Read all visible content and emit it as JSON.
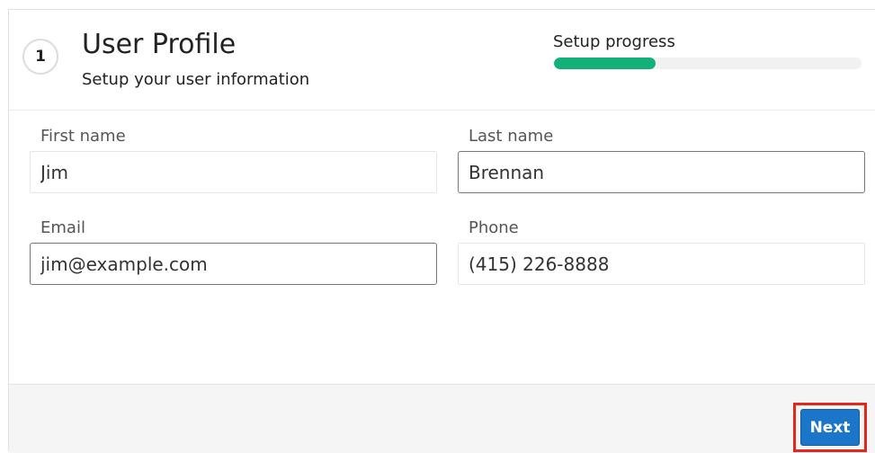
{
  "header": {
    "step_number": "1",
    "title": "User Profile",
    "subtitle": "Setup your user information",
    "progress_label": "Setup progress",
    "progress_fraction": 0.33,
    "progress_color": "#13b07a"
  },
  "form": {
    "first_name": {
      "label": "First name",
      "value": "Jim"
    },
    "last_name": {
      "label": "Last name",
      "value": "Brennan"
    },
    "email": {
      "label": "Email",
      "value": "jim@example.com"
    },
    "phone": {
      "label": "Phone",
      "value": "(415) 226-8888"
    }
  },
  "footer": {
    "next_label": "Next",
    "next_color": "#1b75c9",
    "highlight_color": "#e2271b"
  }
}
